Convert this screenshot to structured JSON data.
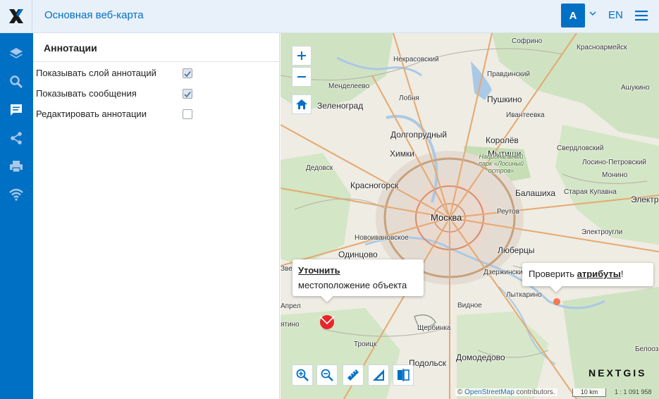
{
  "header": {
    "title": "Основная веб-карта",
    "user_initial": "A",
    "language": "EN"
  },
  "sidebar": {
    "items": [
      {
        "icon": "layers-icon"
      },
      {
        "icon": "search-icon"
      },
      {
        "icon": "annotations-icon",
        "active": true
      },
      {
        "icon": "share-icon"
      },
      {
        "icon": "print-icon"
      },
      {
        "icon": "wifi-icon"
      }
    ]
  },
  "panel": {
    "title": "Аннотации",
    "options": [
      {
        "label": "Показывать слой аннотаций",
        "checked": true
      },
      {
        "label": "Показывать сообщения",
        "checked": true
      },
      {
        "label": "Редактировать аннотации",
        "checked": false
      }
    ]
  },
  "map": {
    "places": [
      {
        "name": "Софрино"
      },
      {
        "name": "Красноармейск"
      },
      {
        "name": "Некрасовский"
      },
      {
        "name": "Правдинский"
      },
      {
        "name": "Менделеево"
      },
      {
        "name": "Ашукино"
      },
      {
        "name": "Лобня"
      },
      {
        "name": "Пушкино"
      },
      {
        "name": "Зеленоград"
      },
      {
        "name": "Ивантеевка"
      },
      {
        "name": "Долгопрудный"
      },
      {
        "name": "Королёв"
      },
      {
        "name": "Химки"
      },
      {
        "name": "Мытищи"
      },
      {
        "name": "Свердловский"
      },
      {
        "name": "Национальный парк «Лосиный остров»"
      },
      {
        "name": "Лосино-Петровский"
      },
      {
        "name": "Дедовск"
      },
      {
        "name": "Монино"
      },
      {
        "name": "Красногорск"
      },
      {
        "name": "Балашиха"
      },
      {
        "name": "Старая Купавна"
      },
      {
        "name": "Электр"
      },
      {
        "name": "Реутов"
      },
      {
        "name": "Москва"
      },
      {
        "name": "Электроугли"
      },
      {
        "name": "Новоивановское"
      },
      {
        "name": "Одинцово"
      },
      {
        "name": "Люберцы"
      },
      {
        "name": "Дзержинский"
      },
      {
        "name": "Лыткарино"
      },
      {
        "name": "Видное"
      },
      {
        "name": "Щербинка"
      },
      {
        "name": "Троицк"
      },
      {
        "name": "Подольск"
      },
      {
        "name": "Домодедово"
      },
      {
        "name": "Белоозё"
      },
      {
        "name": "Звени"
      },
      {
        "name": "Апрел"
      },
      {
        "name": "ятино"
      }
    ],
    "popup_left": {
      "link": "Уточнить",
      "text": "местоположение объекта"
    },
    "popup_right": {
      "prefix": "Проверить ",
      "link": "атрибуты",
      "suffix": "!"
    },
    "brand": "NEXTGIS",
    "attribution_symbol": "©",
    "attribution_link": "OpenStreetMap",
    "attribution_suffix": "contributors.",
    "scale_label": "10 km",
    "scale_ratio": "1 : 1 091 958",
    "tools": [
      "zoom-in-box-icon",
      "zoom-out-box-icon",
      "ruler-icon",
      "area-measure-icon",
      "swipe-icon"
    ],
    "colors": {
      "accent": "#0070c5",
      "marker_left": "#e8262b",
      "marker_right": "#f07a55"
    }
  }
}
